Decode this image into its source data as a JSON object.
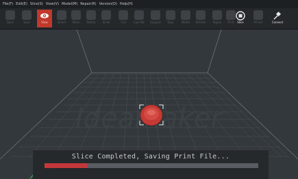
{
  "menu": [
    "File(F)",
    "Edit(E)",
    "Slice(S)",
    "View(V)",
    "Model(M)",
    "Repair(R)",
    "Version(O)",
    "Help(H)"
  ],
  "toolbar": {
    "tools": [
      {
        "name": "open",
        "label": "Open",
        "icon": "folder-icon"
      },
      {
        "name": "save",
        "label": "Save",
        "icon": "save-icon"
      },
      {
        "name": "view",
        "label": "View",
        "icon": "eye-icon",
        "active": true
      },
      {
        "name": "select",
        "label": "Select",
        "icon": "hand-icon"
      },
      {
        "name": "move",
        "label": "Move",
        "icon": "move-icon"
      },
      {
        "name": "rotate",
        "label": "Rotate",
        "icon": "rotate-icon"
      },
      {
        "name": "scale",
        "label": "Scale",
        "icon": "scale-icon"
      },
      {
        "name": "cut",
        "label": "Cut",
        "icon": "cut-icon"
      },
      {
        "name": "lay",
        "label": "Lay Flat",
        "icon": "lay-icon"
      },
      {
        "name": "support",
        "label": "Support",
        "icon": "support-icon"
      },
      {
        "name": "stop",
        "label": "Stop",
        "icon": "stop-icon"
      },
      {
        "name": "model",
        "label": "Model",
        "icon": "model-icon"
      },
      {
        "name": "refresh",
        "label": "Refresh",
        "icon": "refresh-icon"
      },
      {
        "name": "repair",
        "label": "Repair",
        "icon": "wrench-icon"
      },
      {
        "name": "print",
        "label": "Print",
        "icon": "play-icon"
      },
      {
        "name": "slice",
        "label": "Slice",
        "icon": "slice-icon",
        "bright": true
      },
      {
        "name": "printer",
        "label": "Printer",
        "icon": "printer-icon"
      },
      {
        "name": "connect",
        "label": "Connect",
        "icon": "connect-icon",
        "bright": true
      }
    ]
  },
  "scene": {
    "watermark": "Ideamaker"
  },
  "status": {
    "message": "Slice Completed, Saving Print File...",
    "progress": 0.2
  },
  "colors": {
    "accent": "#c0392b",
    "progress": "#c4373a",
    "background": "#33383c"
  }
}
